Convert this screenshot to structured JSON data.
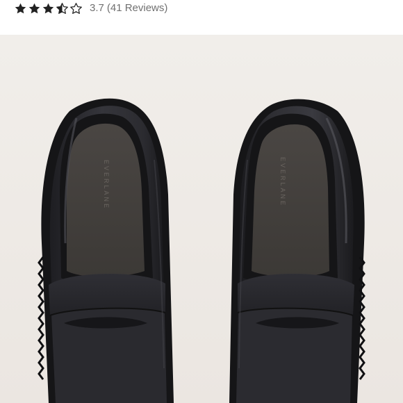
{
  "rating": {
    "value": 3.7,
    "stars_filled": 3.5,
    "stars_total": 5,
    "value_label": "3.7",
    "reviews_label": "(41 Reviews)",
    "star_color": "#222222"
  },
  "product_image": {
    "background_color": "#efebe7",
    "shoe_color": "#2a2a2e",
    "insole_label": "EVERLANE"
  }
}
